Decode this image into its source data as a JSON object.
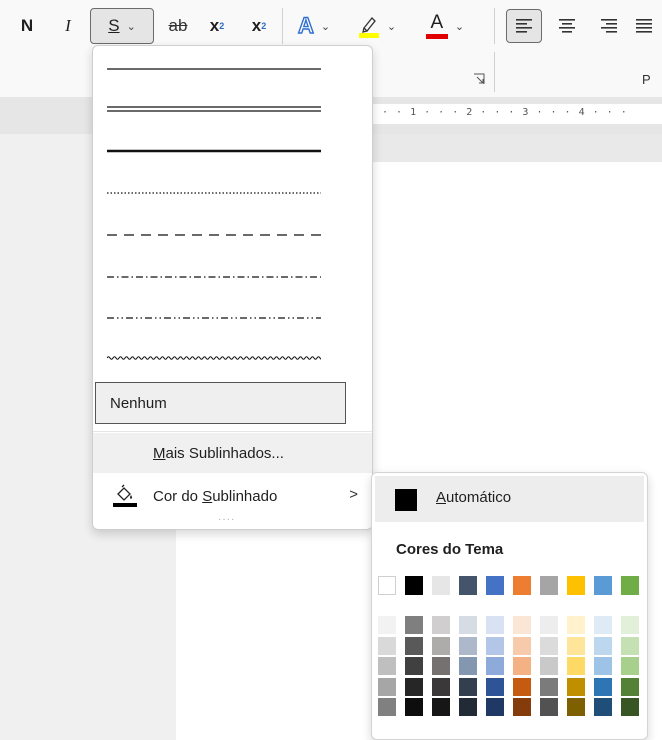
{
  "ribbon": {
    "bold_label": "N",
    "italic_label": "I",
    "underline_label": "S",
    "strikethrough_label": "ab",
    "subscript_label": "x",
    "subscript_sub": "2",
    "superscript_label": "x",
    "superscript_sup": "2",
    "text_effects_label": "A",
    "font_color_label": "A",
    "group_label_fragment": "P"
  },
  "ruler": {
    "text": "· · 1 · · · 2 · · · 3 · · · 4 · · ·"
  },
  "underline_menu": {
    "styles": [
      "single",
      "double",
      "thick",
      "dotted",
      "dashed",
      "dash-dot",
      "dash-dot-dot",
      "wavy"
    ],
    "none_label": "Nenhum",
    "more_label": "Mais Sublinhados...",
    "color_label": "Cor do Sublinhado",
    "color_chevron": ">",
    "grip": "····"
  },
  "color_menu": {
    "automatic_label": "Automático",
    "automatic_color": "#000000",
    "theme_title": "Cores do Tema",
    "theme_colors": [
      "#ffffff",
      "#000000",
      "#e7e6e6",
      "#44546a",
      "#4472c4",
      "#ed7d31",
      "#a5a5a5",
      "#ffc000",
      "#5b9bd5",
      "#70ad47"
    ],
    "shades": [
      [
        "#f2f2f2",
        "#d9d9d9",
        "#bfbfbf",
        "#a6a6a6",
        "#808080"
      ],
      [
        "#7f7f7f",
        "#595959",
        "#404040",
        "#262626",
        "#0d0d0d"
      ],
      [
        "#d0cece",
        "#aeabab",
        "#757171",
        "#3a3838",
        "#171616"
      ],
      [
        "#d6dce4",
        "#adb9ca",
        "#8497b0",
        "#333f4f",
        "#222a35"
      ],
      [
        "#d9e2f3",
        "#b4c6e7",
        "#8eaadb",
        "#2f5496",
        "#1f3864"
      ],
      [
        "#fbe5d5",
        "#f7caac",
        "#f4b183",
        "#c55a11",
        "#843c0b"
      ],
      [
        "#ededed",
        "#dbdbdb",
        "#c9c9c9",
        "#7b7b7b",
        "#525252"
      ],
      [
        "#fff2cc",
        "#ffe599",
        "#ffd966",
        "#bf8f00",
        "#7f6000"
      ],
      [
        "#deebf6",
        "#bdd7ee",
        "#9dc3e6",
        "#2e75b5",
        "#1f4e79"
      ],
      [
        "#e2efd9",
        "#c5e0b3",
        "#a8d08d",
        "#538135",
        "#375623"
      ]
    ]
  }
}
